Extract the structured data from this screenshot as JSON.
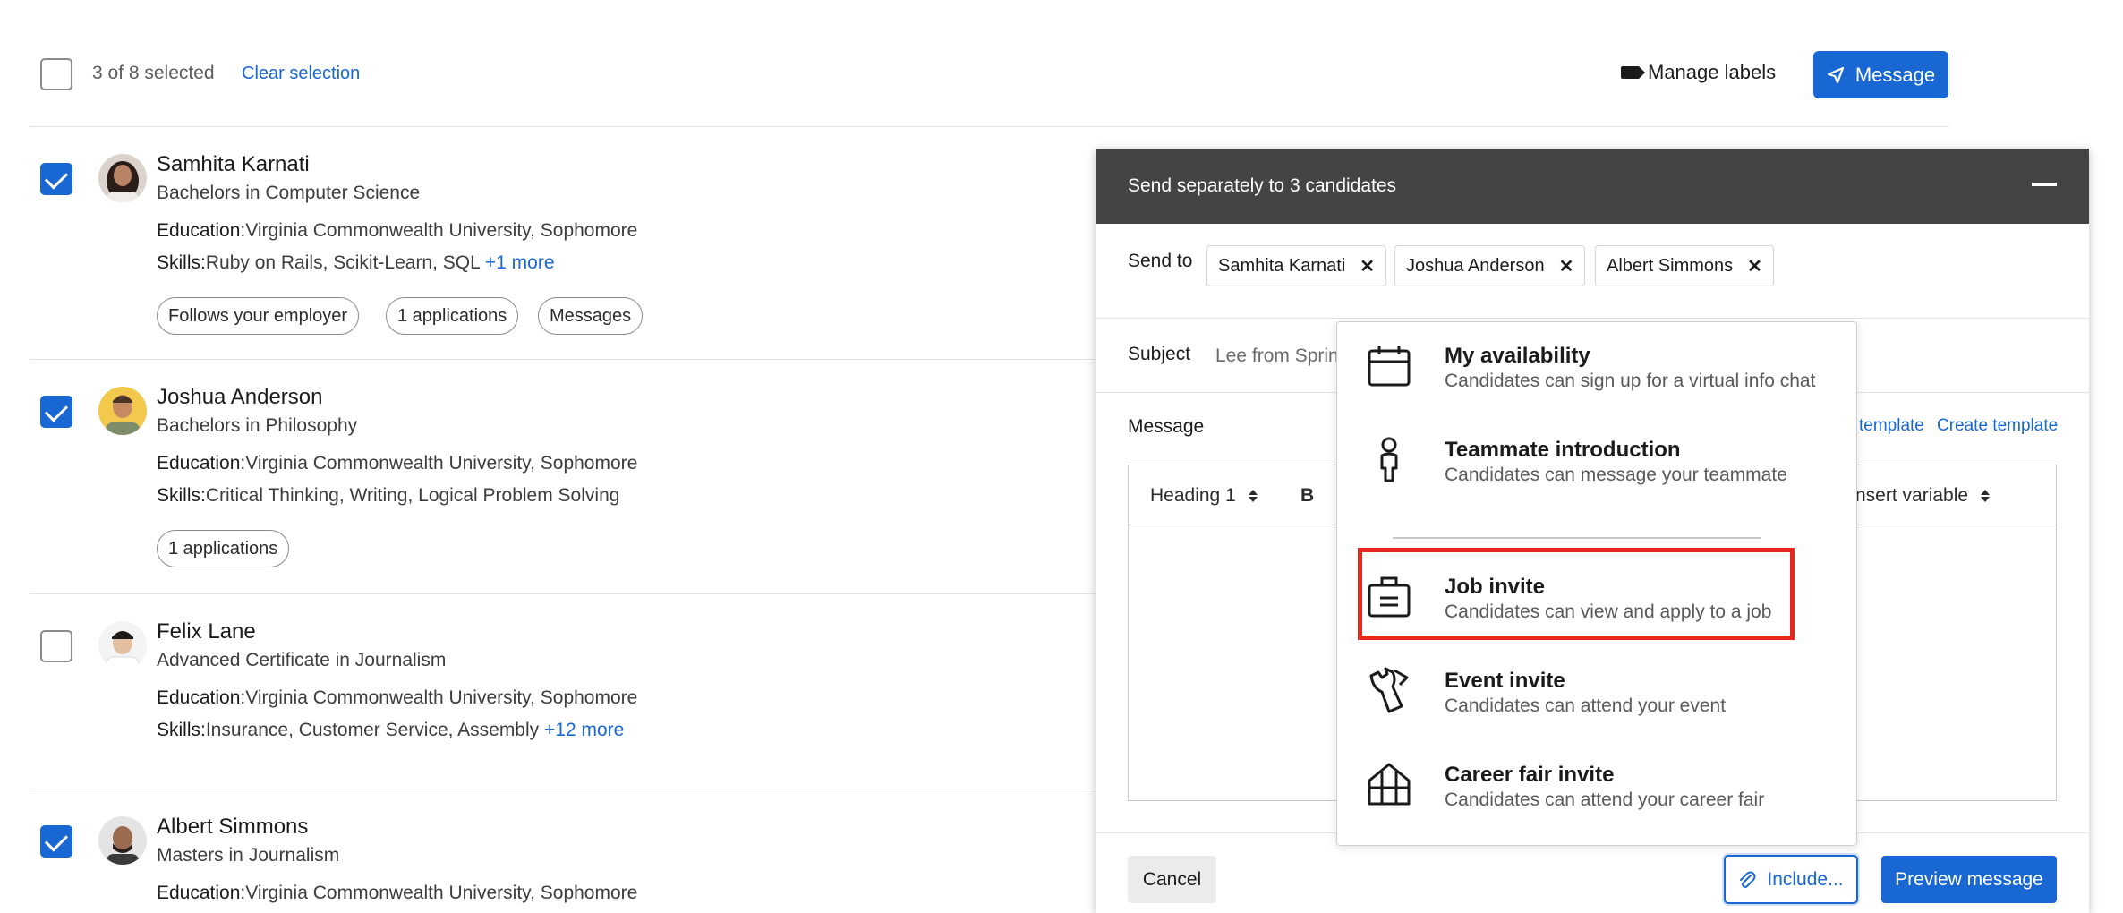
{
  "toolbar": {
    "selection_text": "3 of 8 selected",
    "clear_selection": "Clear selection",
    "manage_labels": "Manage labels",
    "message": "Message"
  },
  "candidates": [
    {
      "name": "Samhita Karnati",
      "degree": "Bachelors in Computer Science",
      "education_label": "Education:",
      "education": "Virginia Commonwealth University, Sophomore",
      "skills_label": "Skills:",
      "skills": "Ruby on Rails, Scikit-Learn, SQL",
      "more": "+1 more",
      "tags": [
        "Follows your employer",
        "1 applications",
        "Messages"
      ],
      "selected": true
    },
    {
      "name": "Joshua Anderson",
      "degree": "Bachelors in Philosophy",
      "education_label": "Education:",
      "education": "Virginia Commonwealth University, Sophomore",
      "skills_label": "Skills:",
      "skills": "Critical Thinking, Writing, Logical Problem Solving",
      "tags": [
        "1 applications"
      ],
      "selected": true
    },
    {
      "name": "Felix Lane",
      "degree": "Advanced Certificate in Journalism",
      "education_label": "Education:",
      "education": "Virginia Commonwealth University, Sophomore",
      "skills_label": "Skills:",
      "skills": "Insurance, Customer Service, Assembly",
      "more": "+12 more",
      "selected": false
    },
    {
      "name": "Albert Simmons",
      "degree": "Masters in Journalism",
      "education_label": "Education:",
      "education": "Virginia Commonwealth University, Sophomore",
      "selected": true
    }
  ],
  "compose": {
    "title": "Send separately to 3 candidates",
    "send_to_label": "Send to",
    "recipients": [
      "Samhita Karnati",
      "Joshua Anderson",
      "Albert Simmons"
    ],
    "subject_label": "Subject",
    "subject_value": "Lee from Sprin",
    "message_label": "Message",
    "use_template": "template",
    "create_template": "Create template",
    "heading_select": "Heading 1",
    "bold": "B",
    "insert_variable": "nsert variable",
    "cancel": "Cancel",
    "include": "Include...",
    "preview": "Preview message"
  },
  "include_menu": [
    {
      "title": "My availability",
      "subtitle": "Candidates can sign up for a virtual info chat",
      "icon": "calendar-icon"
    },
    {
      "title": "Teammate introduction",
      "subtitle": "Candidates can message your teammate",
      "icon": "person-icon"
    },
    {
      "title": "Job invite",
      "subtitle": "Candidates can view and apply to a job",
      "icon": "briefcase-icon",
      "highlighted": true
    },
    {
      "title": "Event invite",
      "subtitle": "Candidates can attend your event",
      "icon": "ticket-icon"
    },
    {
      "title": "Career fair invite",
      "subtitle": "Candidates can attend your career fair",
      "icon": "building-icon"
    }
  ],
  "colors": {
    "accent": "#1967d2",
    "header_bg": "#444444",
    "highlight": "#e8261e"
  }
}
